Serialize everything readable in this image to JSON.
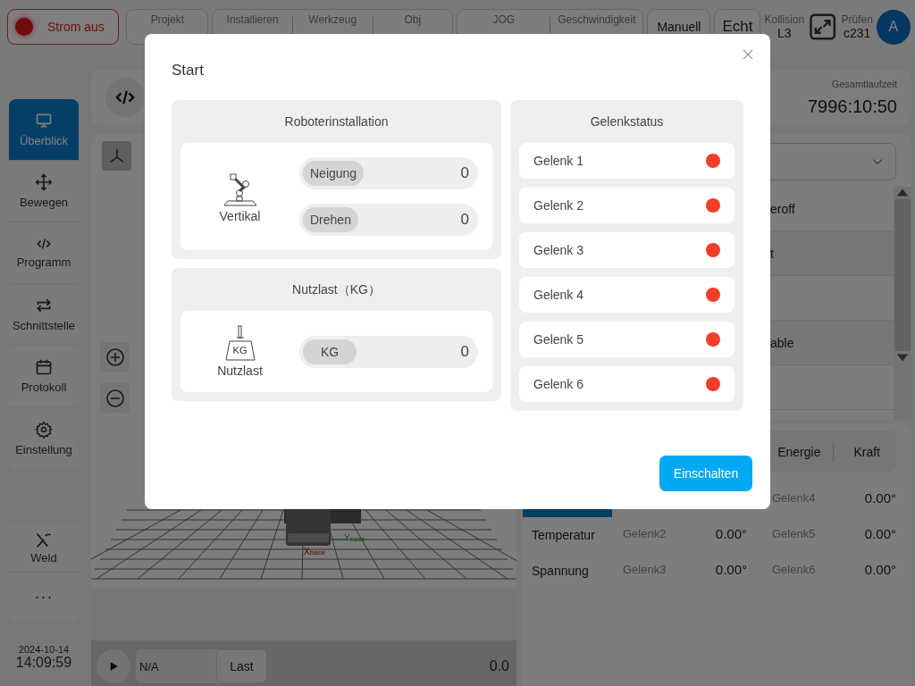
{
  "top_bar": {
    "power": {
      "label": "Strom aus",
      "on": false
    },
    "project": {
      "label": "Projekt"
    },
    "status_groups": [
      [
        {
          "label": "Installieren"
        },
        {
          "label": "Werkzeug"
        },
        {
          "label": "Obj"
        }
      ],
      [
        {
          "label": "JOG"
        },
        {
          "label": "Geschwindigkeit"
        }
      ]
    ],
    "mode_buttons": [
      "Manuell",
      "Echt"
    ],
    "collision": {
      "label": "Kollision",
      "value": "L3"
    },
    "check": {
      "label": "Prüfen",
      "value": "c231"
    },
    "avatar": "A"
  },
  "sidebar": {
    "items": [
      {
        "label": "Überblick",
        "selected": true
      },
      {
        "label": "Bewegen",
        "selected": false
      },
      {
        "label": "Programm",
        "selected": false
      },
      {
        "label": "Schnittstelle",
        "selected": false
      },
      {
        "label": "Protokoll",
        "selected": false
      },
      {
        "label": "Einstellung",
        "selected": false
      }
    ],
    "extra": [
      {
        "label": "Weld"
      },
      {
        "label": "···"
      }
    ],
    "date": "2024-10-14",
    "time": "14:09:59"
  },
  "viewer": {
    "axes": [
      {
        "letter": "X",
        "sub": "base"
      },
      {
        "letter": "Y",
        "sub": "base"
      }
    ],
    "program": "N/A",
    "last_button": "Last",
    "value": "0.0"
  },
  "runtime": {
    "label": "Gesamtlaufzeit",
    "value": "7996:10:50"
  },
  "list": {
    "rows": [
      "eroff",
      "t",
      "",
      "able",
      ""
    ]
  },
  "joint_panel": {
    "tabs": [
      {
        "label": "Energie",
        "selected": false
      },
      {
        "label": "Kraft",
        "selected": false
      }
    ],
    "side_tabs": [
      {
        "selected": true
      },
      {
        "label": "Temperatur",
        "selected": false
      },
      {
        "label": "Spannung",
        "selected": false
      }
    ],
    "values": [
      {
        "name": "Gelenk4",
        "value": "0.00°"
      },
      {
        "name": "Gelenk2",
        "value": "0.00°"
      },
      {
        "name": "Gelenk5",
        "value": "0.00°"
      },
      {
        "name": "Gelenk3",
        "value": "0.00°"
      },
      {
        "name": "Gelenk6",
        "value": "0.00°"
      }
    ]
  },
  "dialog": {
    "title": "Start",
    "installation": {
      "title": "Roboterinstallation",
      "mount": "Vertikal",
      "fields": [
        {
          "label": "Neigung",
          "value": "0"
        },
        {
          "label": "Drehen",
          "value": "0"
        }
      ]
    },
    "payload": {
      "title": "Nutzlast（KG）",
      "icon_text": "KG",
      "name": "Nutzlast",
      "fields": [
        {
          "label": "KG",
          "value": "0"
        }
      ]
    },
    "joints": {
      "title": "Gelenkstatus",
      "items": [
        {
          "name": "Gelenk 1",
          "on": false
        },
        {
          "name": "Gelenk 2",
          "on": false
        },
        {
          "name": "Gelenk 3",
          "on": false
        },
        {
          "name": "Gelenk 4",
          "on": false
        },
        {
          "name": "Gelenk 5",
          "on": false
        },
        {
          "name": "Gelenk 6",
          "on": false
        }
      ]
    },
    "confirm": "Einschalten"
  }
}
